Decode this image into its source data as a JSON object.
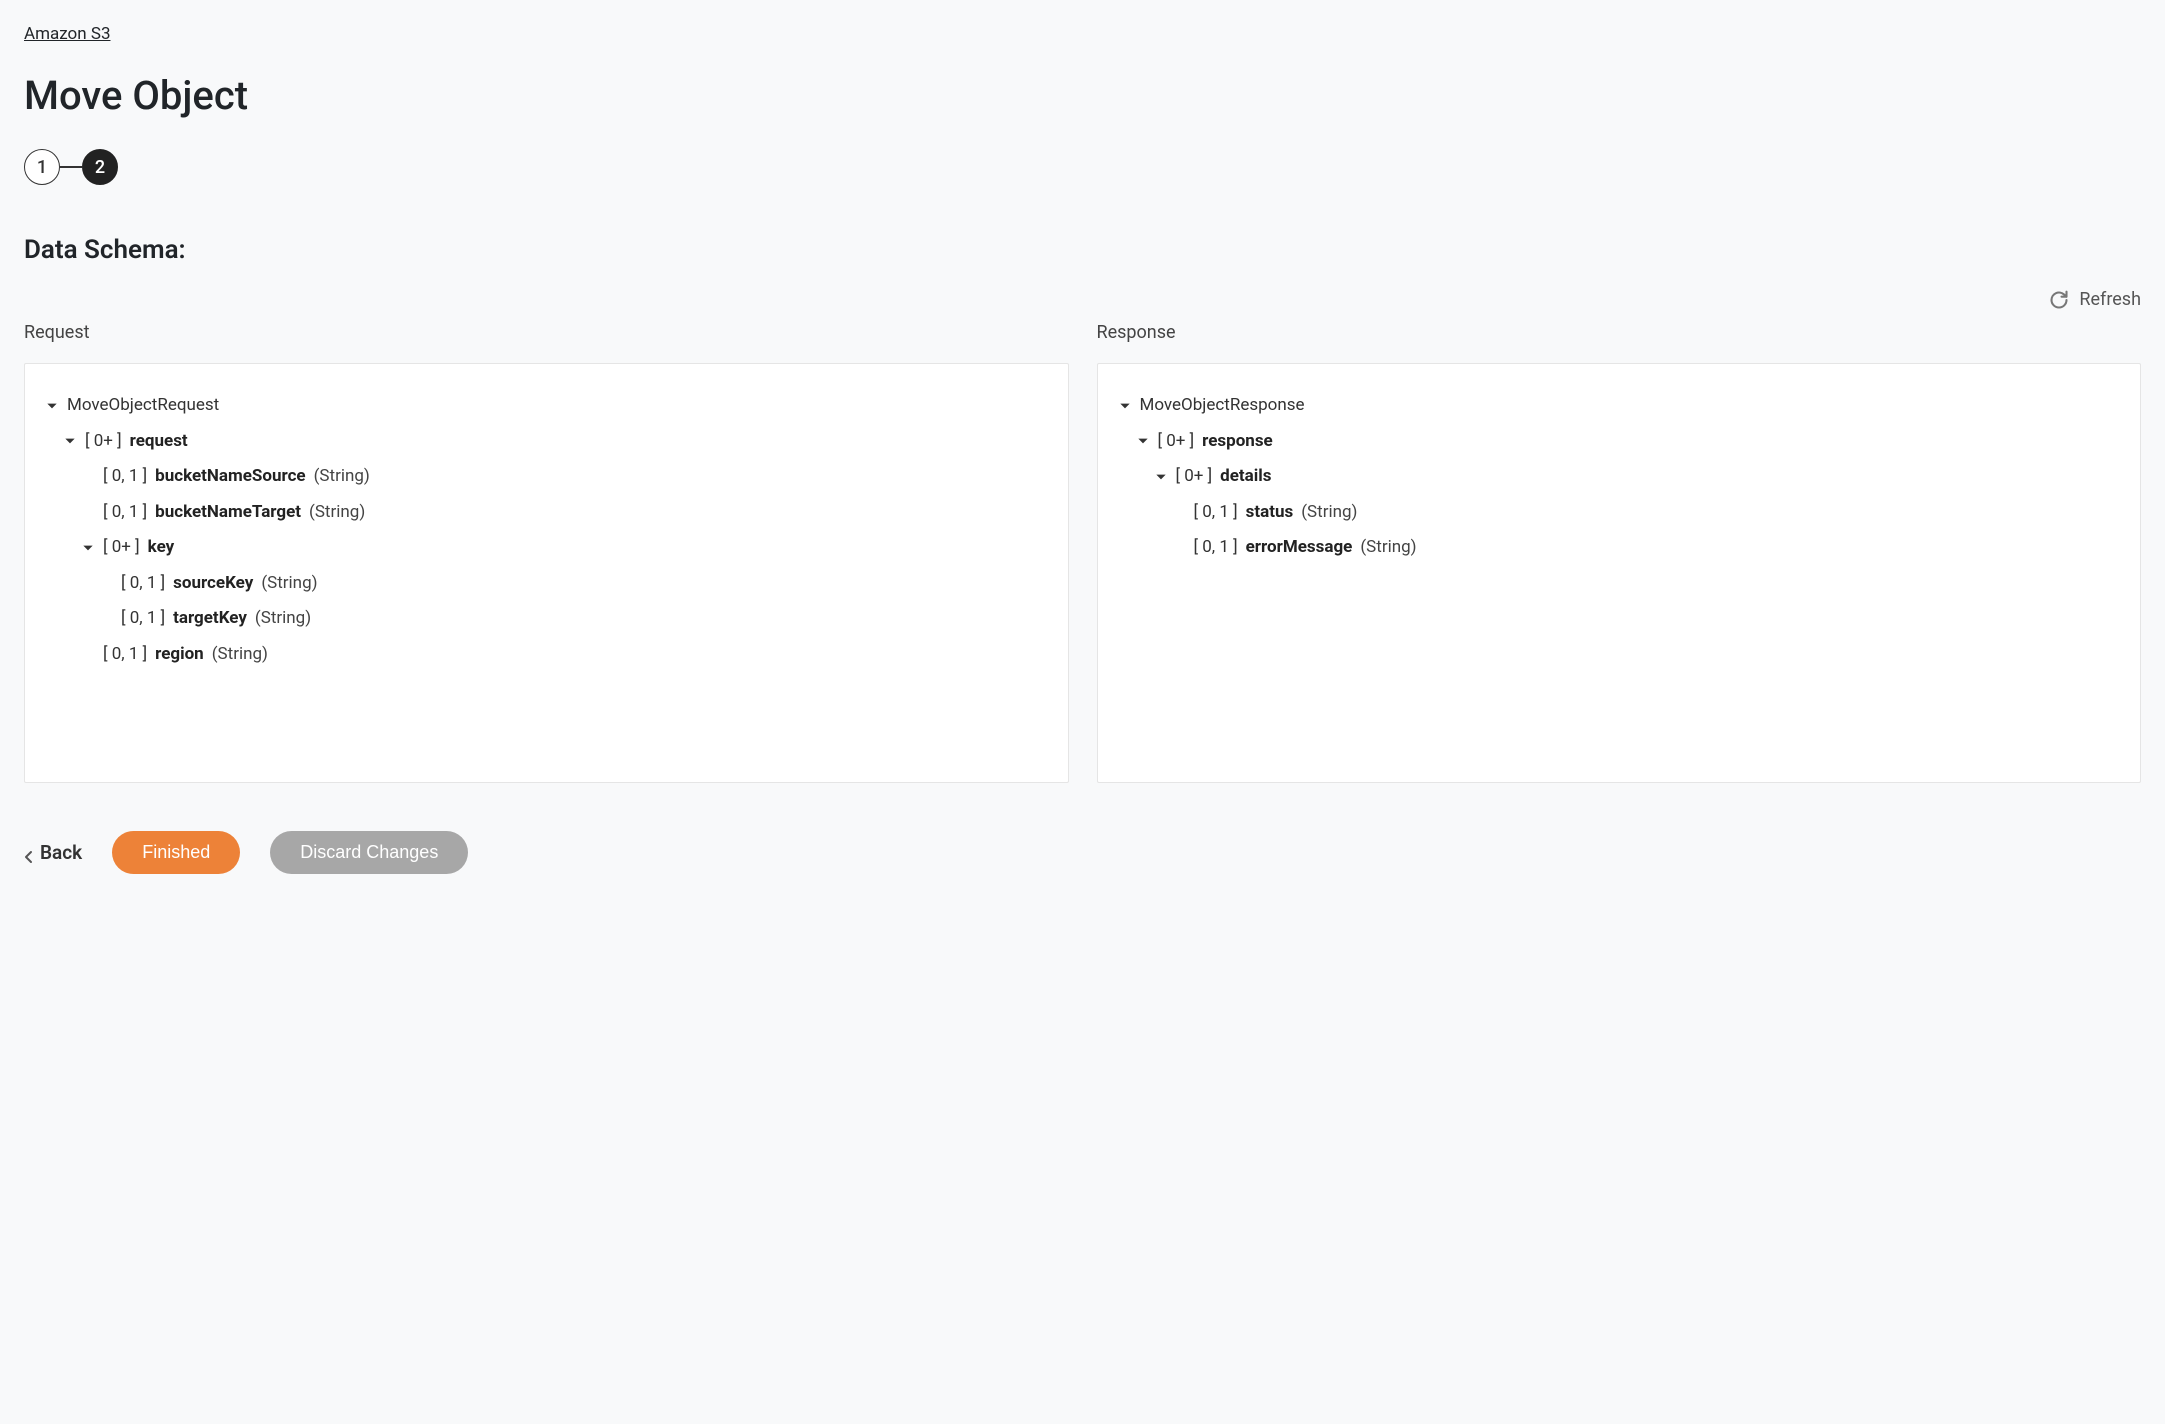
{
  "breadcrumb": {
    "label": "Amazon S3"
  },
  "page": {
    "title": "Move Object",
    "section_title": "Data Schema:"
  },
  "stepper": {
    "step1": "1",
    "step2": "2"
  },
  "refresh": {
    "label": "Refresh"
  },
  "request": {
    "header": "Request",
    "root": "MoveObjectRequest",
    "node_request": {
      "card": "[ 0+ ]",
      "name": "request"
    },
    "node_bucketSource": {
      "card": "[ 0, 1 ]",
      "name": "bucketNameSource",
      "type": "(String)"
    },
    "node_bucketTarget": {
      "card": "[ 0, 1 ]",
      "name": "bucketNameTarget",
      "type": "(String)"
    },
    "node_key": {
      "card": "[ 0+ ]",
      "name": "key"
    },
    "node_sourceKey": {
      "card": "[ 0, 1 ]",
      "name": "sourceKey",
      "type": "(String)"
    },
    "node_targetKey": {
      "card": "[ 0, 1 ]",
      "name": "targetKey",
      "type": "(String)"
    },
    "node_region": {
      "card": "[ 0, 1 ]",
      "name": "region",
      "type": "(String)"
    }
  },
  "response": {
    "header": "Response",
    "root": "MoveObjectResponse",
    "node_response": {
      "card": "[ 0+ ]",
      "name": "response"
    },
    "node_details": {
      "card": "[ 0+ ]",
      "name": "details"
    },
    "node_status": {
      "card": "[ 0, 1 ]",
      "name": "status",
      "type": "(String)"
    },
    "node_errorMessage": {
      "card": "[ 0, 1 ]",
      "name": "errorMessage",
      "type": "(String)"
    }
  },
  "footer": {
    "back": "Back",
    "finished": "Finished",
    "discard": "Discard Changes"
  }
}
